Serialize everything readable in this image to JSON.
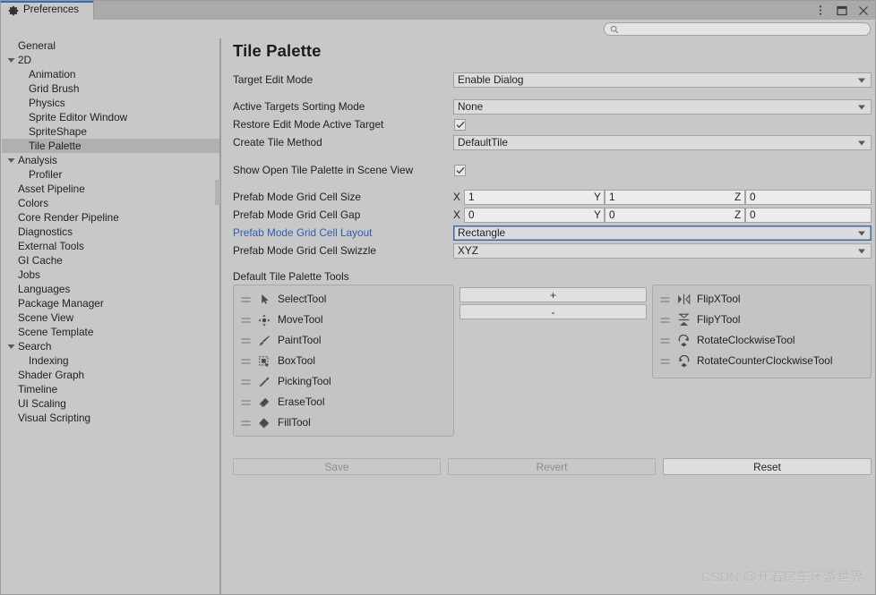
{
  "window": {
    "tab_label": "Preferences",
    "tab_icon": "gear-icon",
    "controls": [
      {
        "name": "more-options-icon",
        "glyph": "kebab-menu"
      },
      {
        "name": "maximize-icon",
        "glyph": "maximize"
      },
      {
        "name": "close-icon",
        "glyph": "close"
      }
    ]
  },
  "search": {
    "value": "",
    "placeholder": "",
    "icon": "search-icon"
  },
  "sidebar": {
    "items": [
      {
        "label": "General",
        "depth": 0,
        "expandable": false,
        "selected": false
      },
      {
        "label": "2D",
        "depth": 0,
        "expandable": true,
        "expanded": true,
        "selected": false
      },
      {
        "label": "Animation",
        "depth": 1,
        "expandable": false,
        "selected": false
      },
      {
        "label": "Grid Brush",
        "depth": 1,
        "expandable": false,
        "selected": false
      },
      {
        "label": "Physics",
        "depth": 1,
        "expandable": false,
        "selected": false
      },
      {
        "label": "Sprite Editor Window",
        "depth": 1,
        "expandable": false,
        "selected": false
      },
      {
        "label": "SpriteShape",
        "depth": 1,
        "expandable": false,
        "selected": false
      },
      {
        "label": "Tile Palette",
        "depth": 1,
        "expandable": false,
        "selected": true
      },
      {
        "label": "Analysis",
        "depth": 0,
        "expandable": true,
        "expanded": true,
        "selected": false
      },
      {
        "label": "Profiler",
        "depth": 1,
        "expandable": false,
        "selected": false
      },
      {
        "label": "Asset Pipeline",
        "depth": 0,
        "expandable": false,
        "selected": false
      },
      {
        "label": "Colors",
        "depth": 0,
        "expandable": false,
        "selected": false
      },
      {
        "label": "Core Render Pipeline",
        "depth": 0,
        "expandable": false,
        "selected": false
      },
      {
        "label": "Diagnostics",
        "depth": 0,
        "expandable": false,
        "selected": false
      },
      {
        "label": "External Tools",
        "depth": 0,
        "expandable": false,
        "selected": false
      },
      {
        "label": "GI Cache",
        "depth": 0,
        "expandable": false,
        "selected": false
      },
      {
        "label": "Jobs",
        "depth": 0,
        "expandable": false,
        "selected": false
      },
      {
        "label": "Languages",
        "depth": 0,
        "expandable": false,
        "selected": false
      },
      {
        "label": "Package Manager",
        "depth": 0,
        "expandable": false,
        "selected": false
      },
      {
        "label": "Scene View",
        "depth": 0,
        "expandable": false,
        "selected": false
      },
      {
        "label": "Scene Template",
        "depth": 0,
        "expandable": false,
        "selected": false
      },
      {
        "label": "Search",
        "depth": 0,
        "expandable": true,
        "expanded": true,
        "selected": false
      },
      {
        "label": "Indexing",
        "depth": 1,
        "expandable": false,
        "selected": false
      },
      {
        "label": "Shader Graph",
        "depth": 0,
        "expandable": false,
        "selected": false
      },
      {
        "label": "Timeline",
        "depth": 0,
        "expandable": false,
        "selected": false
      },
      {
        "label": "UI Scaling",
        "depth": 0,
        "expandable": false,
        "selected": false
      },
      {
        "label": "Visual Scripting",
        "depth": 0,
        "expandable": false,
        "selected": false
      }
    ]
  },
  "main": {
    "title": "Tile Palette",
    "fields": {
      "target_edit_mode": {
        "label": "Target Edit Mode",
        "value": "Enable Dialog"
      },
      "active_targets_sorting_mode": {
        "label": "Active Targets Sorting Mode",
        "value": "None"
      },
      "restore_edit_mode_active_target": {
        "label": "Restore Edit Mode Active Target",
        "checked": true
      },
      "create_tile_method": {
        "label": "Create Tile Method",
        "value": "DefaultTile"
      },
      "show_open_tile_palette_in_scene_view": {
        "label": "Show Open Tile Palette in Scene View",
        "checked": true
      },
      "prefab_mode_grid_cell_size": {
        "label": "Prefab Mode Grid Cell Size",
        "axes": [
          {
            "axis": "X",
            "value": "1"
          },
          {
            "axis": "Y",
            "value": "1"
          },
          {
            "axis": "Z",
            "value": "0"
          }
        ]
      },
      "prefab_mode_grid_cell_gap": {
        "label": "Prefab Mode Grid Cell Gap",
        "axes": [
          {
            "axis": "X",
            "value": "0"
          },
          {
            "axis": "Y",
            "value": "0"
          },
          {
            "axis": "Z",
            "value": "0"
          }
        ]
      },
      "prefab_mode_grid_cell_layout": {
        "label": "Prefab Mode Grid Cell Layout",
        "value": "Rectangle",
        "modified": true,
        "focused": true
      },
      "prefab_mode_grid_cell_swizzle": {
        "label": "Prefab Mode Grid Cell Swizzle",
        "value": "XYZ"
      }
    },
    "tools_section_label": "Default Tile Palette Tools",
    "tools_left": [
      {
        "name": "SelectTool",
        "icon": "cursor-arrow-icon"
      },
      {
        "name": "MoveTool",
        "icon": "move-arrows-icon"
      },
      {
        "name": "PaintTool",
        "icon": "paintbrush-icon"
      },
      {
        "name": "BoxTool",
        "icon": "box-select-icon"
      },
      {
        "name": "PickingTool",
        "icon": "eyedropper-icon"
      },
      {
        "name": "EraseTool",
        "icon": "eraser-icon"
      },
      {
        "name": "FillTool",
        "icon": "paint-bucket-icon"
      }
    ],
    "tools_right": [
      {
        "name": "FlipXTool",
        "icon": "flip-horizontal-icon"
      },
      {
        "name": "FlipYTool",
        "icon": "flip-vertical-icon"
      },
      {
        "name": "RotateClockwiseTool",
        "icon": "rotate-cw-icon"
      },
      {
        "name": "RotateCounterClockwiseTool",
        "icon": "rotate-ccw-icon"
      }
    ],
    "add_button": "+",
    "remove_button": "-",
    "actions": {
      "save": {
        "label": "Save",
        "enabled": false
      },
      "revert": {
        "label": "Revert",
        "enabled": false
      },
      "reset": {
        "label": "Reset",
        "enabled": true
      }
    }
  },
  "watermark": "CSDN @开着房车环游世界",
  "colors": {
    "window_bg": "#c8c8c8",
    "titlebar_bg": "#aaaaaa",
    "tab_accent": "#2c6fbb",
    "selection_bg": "#b0b0b0",
    "modified_label": "#2c5fb3",
    "field_bg": "#dcdcdc",
    "numfield_bg": "#ededed",
    "focus_border": "#3b6ea8"
  }
}
